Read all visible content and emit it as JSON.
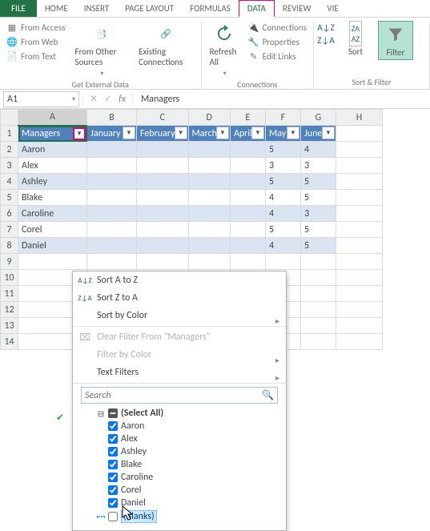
{
  "tabs": [
    "FILE",
    "HOME",
    "INSERT",
    "PAGE LAYOUT",
    "FORMULAS",
    "DATA",
    "REVIEW",
    "VIE"
  ],
  "active_tab": "DATA",
  "ribbon": {
    "ext": {
      "access": "From Access",
      "web": "From Web",
      "text": "From Text",
      "other": "From Other Sources",
      "existing": "Existing Connections",
      "label": "Get External Data"
    },
    "conn": {
      "refresh": "Refresh All",
      "connections": "Connections",
      "properties": "Properties",
      "edit": "Edit Links",
      "label": "Connections"
    },
    "sort": {
      "sort": "Sort",
      "filter": "Filter",
      "label": "Sort & Filter"
    }
  },
  "namebox": "A1",
  "formula": "Managers",
  "columns": [
    "A",
    "B",
    "C",
    "D",
    "E",
    "F",
    "G",
    "H"
  ],
  "headers": [
    "Managers",
    "January",
    "February",
    "March",
    "April",
    "May",
    "June"
  ],
  "rows": [
    {
      "r": 2,
      "name": "Aaron",
      "may": 5,
      "june": 4
    },
    {
      "r": 3,
      "name": "Alex",
      "may": 3,
      "june": 3
    },
    {
      "r": 4,
      "name": "Ashley",
      "may": 5,
      "june": 5
    },
    {
      "r": 5,
      "name": "Blake",
      "may": 4,
      "june": 5
    },
    {
      "r": 6,
      "name": "Caroline",
      "may": 4,
      "june": 3
    },
    {
      "r": 7,
      "name": "Corel",
      "may": 5,
      "june": 5
    },
    {
      "r": 8,
      "name": "Daniel",
      "may": 4,
      "june": 5
    }
  ],
  "empty_rows": [
    9,
    10,
    11,
    12,
    13,
    14
  ],
  "filter": {
    "sort_az": "Sort A to Z",
    "sort_za": "Sort Z to A",
    "sort_color": "Sort by Color",
    "clear": "Clear Filter From \"Managers\"",
    "filter_color": "Filter by Color",
    "text_filters": "Text Filters",
    "search_placeholder": "Search",
    "items": [
      {
        "label": "(Select All)",
        "checked": false,
        "all": true
      },
      {
        "label": "Aaron",
        "checked": true
      },
      {
        "label": "Alex",
        "checked": true
      },
      {
        "label": "Ashley",
        "checked": true
      },
      {
        "label": "Blake",
        "checked": true
      },
      {
        "label": "Caroline",
        "checked": true
      },
      {
        "label": "Corel",
        "checked": true
      },
      {
        "label": "Daniel",
        "checked": true
      },
      {
        "label": "(Blanks)",
        "checked": false,
        "selected": true
      }
    ]
  }
}
